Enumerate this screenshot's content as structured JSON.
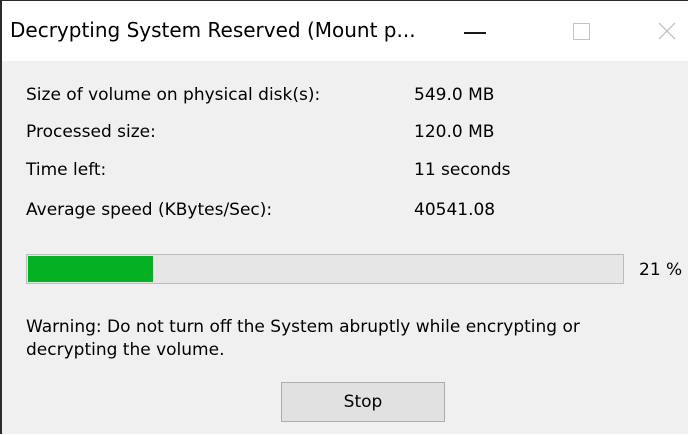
{
  "window": {
    "title": "Decrypting System Reserved (Mount p..."
  },
  "stats": [
    {
      "label": "Size of volume on physical disk(s):",
      "value": "549.0 MB"
    },
    {
      "label": "Processed size:",
      "value": "120.0 MB"
    },
    {
      "label": "Time left:",
      "value": "11 seconds"
    },
    {
      "label": "Average speed (KBytes/Sec):",
      "value": "40541.08"
    }
  ],
  "progress": {
    "percent": 21,
    "percent_text": "21 %",
    "fill_color": "#06b025"
  },
  "warning_text": "Warning: Do not turn off the System abruptly while encrypting or decrypting the volume.",
  "buttons": {
    "stop_label": "Stop"
  }
}
